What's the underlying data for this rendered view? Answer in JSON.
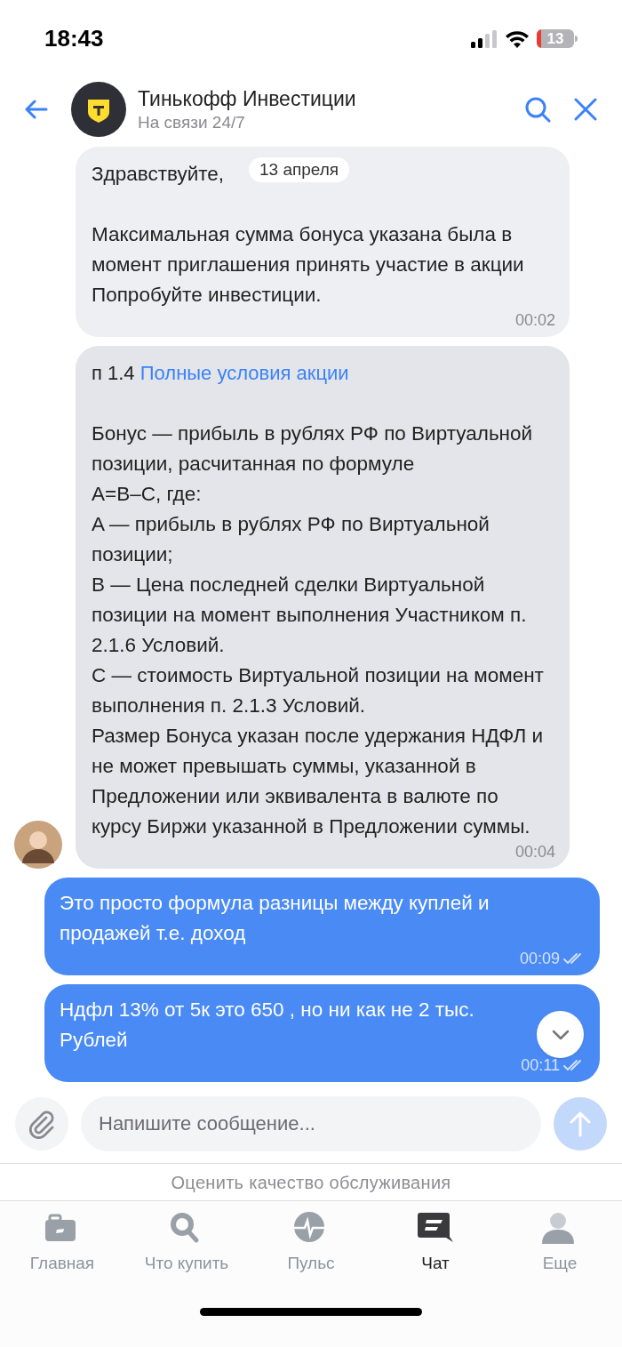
{
  "status_bar": {
    "time": "18:43",
    "battery": "13"
  },
  "header": {
    "title": "Тинькофф Инвестиции",
    "subtitle": "На связи 24/7"
  },
  "date_label": "13 апреля",
  "messages": [
    {
      "kind": "incoming",
      "text": "Здравствуйте,\n\nМаксимальная сумма бонуса указана была в момент приглашения  принять участие в акции Попробуйте инвестиции.",
      "time": "00:02",
      "avatar": false
    },
    {
      "kind": "incoming",
      "prefix": "п 1.4 ",
      "link": "Полные условия акции",
      "text": "\nБонус — прибыль в рублях РФ по Виртуальной позиции, расчитанная по формуле\nA=B–C, где:\nA — прибыль в рублях РФ по Виртуальной позиции;\nB — Цена последней сделки Виртуальной позиции на момент выполнения Участником п. 2.1.6 Условий.\nC — стоимость Виртуальной позиции на момент выполнения п. 2.1.3 Условий.\nРазмер Бонуса указан после удержания НДФЛ и не может превышать суммы, указанной в Предложении или эквивалента в валюте по курсу Биржи указанной в Предложении суммы.",
      "time": "00:04",
      "avatar": true
    },
    {
      "kind": "outgoing",
      "text": "Это просто формула разницы между куплей и продажей т.е. доход",
      "time": "00:09"
    },
    {
      "kind": "outgoing",
      "text": "Ндфл 13% от 5к это 650 , но ни как не 2 тыс. Рублей",
      "time": "00:11"
    }
  ],
  "composer": {
    "placeholder": "Напишите сообщение..."
  },
  "rate_link": "Оценить качество обслуживания",
  "tabs": [
    {
      "label": "Главная",
      "selected": false
    },
    {
      "label": "Что купить",
      "selected": false
    },
    {
      "label": "Пульс",
      "selected": false
    },
    {
      "label": "Чат",
      "selected": true
    },
    {
      "label": "Еще",
      "selected": false
    }
  ]
}
